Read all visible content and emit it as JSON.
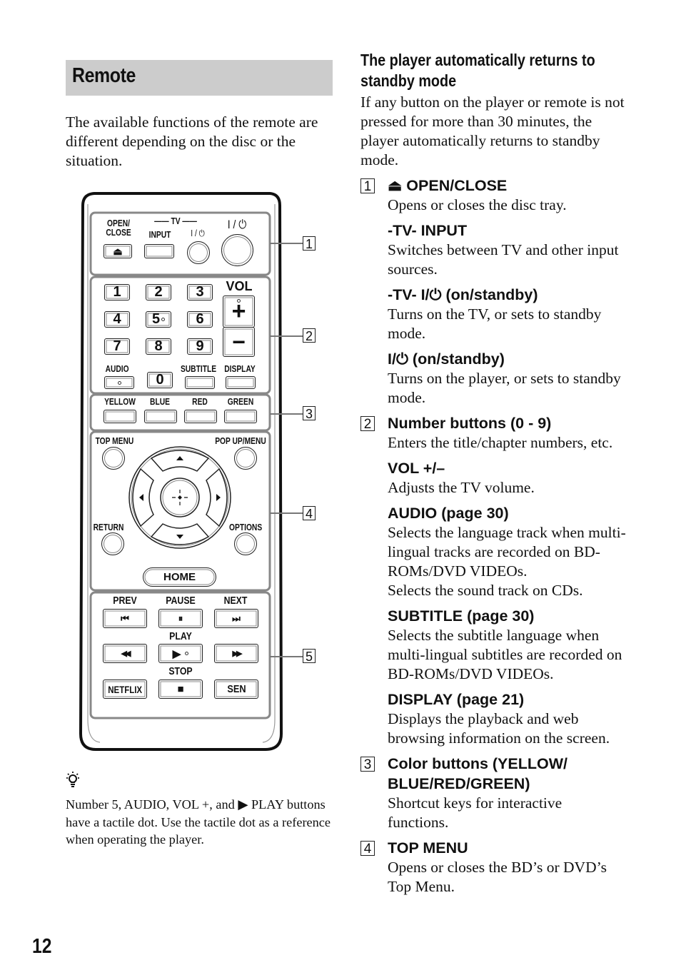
{
  "section_title": "Remote",
  "intro": "The available functions of the remote are different depending on the disc or the situation.",
  "remote": {
    "open_close_label": "OPEN/\nCLOSE",
    "tv_group_label": "TV",
    "input_label": "INPUT",
    "tv_power_label": "I / ⏻",
    "power_label": "I / ⏻",
    "numbers": [
      "1",
      "2",
      "3",
      "4",
      "5",
      "6",
      "7",
      "8",
      "9",
      "0"
    ],
    "vol_label": "VOL",
    "vol_plus": "+",
    "vol_minus": "−",
    "audio_label": "AUDIO",
    "subtitle_label": "SUBTITLE",
    "display_label": "DISPLAY",
    "color_labels": [
      "YELLOW",
      "BLUE",
      "RED",
      "GREEN"
    ],
    "top_menu_label": "TOP MENU",
    "popup_menu_label": "POP UP/MENU",
    "return_label": "RETURN",
    "options_label": "OPTIONS",
    "home_label": "HOME",
    "prev_label": "PREV",
    "pause_label": "PAUSE",
    "next_label": "NEXT",
    "play_label": "PLAY",
    "stop_label": "STOP",
    "netflix_label": "NETFLIX",
    "sen_label": "SEN",
    "glyphs": {
      "eject": "⏏",
      "prev": "⏮",
      "pause": "⏸",
      "next": "⏭",
      "rewind": "◀◀",
      "play": "▶",
      "ffwd": "▶▶",
      "stop": "■",
      "up": "▲",
      "down": "▼",
      "left": "◀",
      "right": "▶"
    },
    "callouts": [
      "1",
      "2",
      "3",
      "4",
      "5"
    ]
  },
  "hint": {
    "icon": "lightbulb-hint-icon",
    "text_before": "Number 5, AUDIO, VOL +, and ",
    "play_glyph": "▶",
    "text_after": " PLAY buttons have a tactile dot. Use the tactile dot as a reference when operating the player."
  },
  "standby": {
    "heading": "The player automatically returns to standby mode",
    "body": "If any button on the player or remote is not pressed for more than 30 minutes, the player automatically returns to standby mode."
  },
  "items": [
    {
      "number": "1",
      "entries": [
        {
          "title": "⏏ OPEN/CLOSE",
          "desc": "Opens or closes the disc tray."
        },
        {
          "title": "-TV- INPUT",
          "desc": "Switches between TV and other input sources."
        },
        {
          "title": "-TV- I/⏻ (on/standby)",
          "desc": "Turns on the TV, or sets to standby mode."
        },
        {
          "title": "I/⏻ (on/standby)",
          "desc": "Turns on the player, or sets to standby mode."
        }
      ]
    },
    {
      "number": "2",
      "entries": [
        {
          "title": "Number buttons (0 - 9)",
          "desc": "Enters the title/chapter numbers, etc."
        },
        {
          "title": "VOL +/–",
          "desc": "Adjusts the TV volume."
        },
        {
          "title": "AUDIO (page 30)",
          "desc": "Selects the language track when multi-lingual tracks are recorded on BD-ROMs/DVD VIDEOs.",
          "desc2": "Selects the sound track on CDs."
        },
        {
          "title": "SUBTITLE (page 30)",
          "desc": "Selects the subtitle language when multi-lingual subtitles are recorded on BD-ROMs/DVD VIDEOs."
        },
        {
          "title": "DISPLAY (page 21)",
          "desc": "Displays the playback and web browsing information on the screen."
        }
      ]
    },
    {
      "number": "3",
      "entries": [
        {
          "title": "Color buttons (YELLOW/ BLUE/RED/GREEN)",
          "desc": "Shortcut keys for interactive functions."
        }
      ]
    },
    {
      "number": "4",
      "entries": [
        {
          "title": "TOP MENU",
          "desc": "Opens or closes the BD’s or DVD’s Top Menu."
        }
      ]
    }
  ],
  "page_number": "12"
}
